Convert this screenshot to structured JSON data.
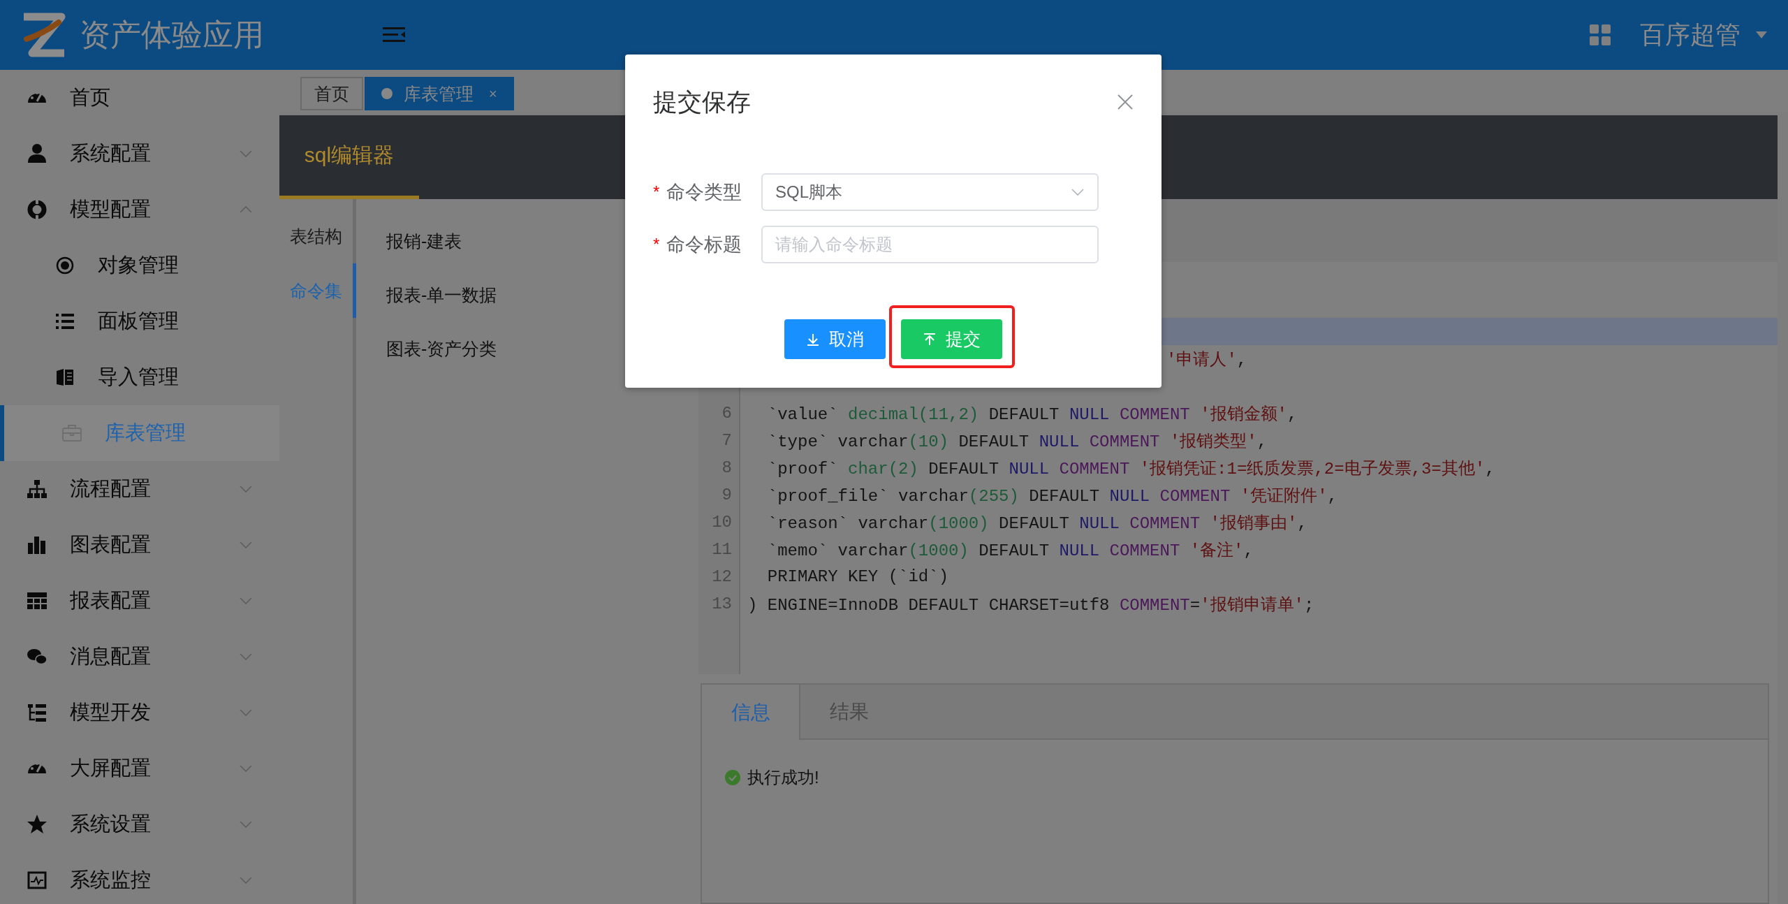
{
  "topbar": {
    "app_title": "资产体验应用",
    "user": "百序超管"
  },
  "sidebar": {
    "items": [
      {
        "label": "首页",
        "selected": false
      },
      {
        "label": "系统配置",
        "selected": false,
        "expanded": false
      },
      {
        "label": "模型配置",
        "selected": false,
        "expanded": true,
        "children": [
          {
            "label": "对象管理",
            "selected": false
          },
          {
            "label": "面板管理",
            "selected": false
          },
          {
            "label": "导入管理",
            "selected": false
          },
          {
            "label": "库表管理",
            "selected": true
          }
        ]
      },
      {
        "label": "流程配置",
        "selected": false,
        "expanded": false
      },
      {
        "label": "图表配置",
        "selected": false,
        "expanded": false
      },
      {
        "label": "报表配置",
        "selected": false,
        "expanded": false
      },
      {
        "label": "消息配置",
        "selected": false,
        "expanded": false
      },
      {
        "label": "模型开发",
        "selected": false,
        "expanded": false
      },
      {
        "label": "大屏配置",
        "selected": false,
        "expanded": false
      },
      {
        "label": "系统设置",
        "selected": false,
        "expanded": false
      },
      {
        "label": "系统监控",
        "selected": false,
        "expanded": false
      }
    ]
  },
  "page_tabs": [
    {
      "label": "首页",
      "selected": false
    },
    {
      "label": "库表管理",
      "selected": true,
      "close": "×"
    }
  ],
  "editor": {
    "tabs": [
      {
        "label": "sql编辑器",
        "selected": true
      }
    ],
    "side_tabs": [
      {
        "label": "表结构",
        "selected": false
      },
      {
        "label": "命令集",
        "selected": true
      }
    ],
    "commands": [
      "报销-建表",
      "报表-单一数据",
      "图表-资产分类"
    ],
    "code_lines": [
      {
        "active": true
      },
      {
        "clipped": true,
        "active": false,
        "tokens": [
          {
            "text": "'申请人'",
            "kind": "string"
          },
          {
            "text": ",",
            "kind": "plain"
          }
        ]
      },
      {
        "active": false
      },
      {
        "number": "6",
        "active": false,
        "tokens": [
          {
            "text": "  `value` ",
            "kind": "plain"
          },
          {
            "text": "decimal",
            "kind": "type"
          },
          {
            "text": "(11,2)",
            "kind": "number"
          },
          {
            "text": " DEFAULT ",
            "kind": "plain"
          },
          {
            "text": "NULL",
            "kind": "atom"
          },
          {
            "text": " COMMENT",
            "kind": "keyword"
          },
          {
            "text": " '报销金额'",
            "kind": "string"
          },
          {
            "text": ",",
            "kind": "plain"
          }
        ]
      },
      {
        "number": "7",
        "active": false,
        "tokens": [
          {
            "text": "  `type` varchar",
            "kind": "plain"
          },
          {
            "text": "(10)",
            "kind": "number"
          },
          {
            "text": " DEFAULT ",
            "kind": "plain"
          },
          {
            "text": "NULL",
            "kind": "atom"
          },
          {
            "text": " COMMENT",
            "kind": "keyword"
          },
          {
            "text": " '报销类型'",
            "kind": "string"
          },
          {
            "text": ",",
            "kind": "plain"
          }
        ]
      },
      {
        "number": "8",
        "active": false,
        "tokens": [
          {
            "text": "  `proof` ",
            "kind": "plain"
          },
          {
            "text": "char",
            "kind": "type"
          },
          {
            "text": "(2)",
            "kind": "number"
          },
          {
            "text": " DEFAULT ",
            "kind": "plain"
          },
          {
            "text": "NULL",
            "kind": "atom"
          },
          {
            "text": " COMMENT",
            "kind": "keyword"
          },
          {
            "text": " '报销凭证:1=纸质发票,2=电子发票,3=其他'",
            "kind": "string"
          },
          {
            "text": ",",
            "kind": "plain"
          }
        ]
      },
      {
        "number": "9",
        "active": false,
        "tokens": [
          {
            "text": "  `proof_file` varchar",
            "kind": "plain"
          },
          {
            "text": "(255)",
            "kind": "number"
          },
          {
            "text": " DEFAULT ",
            "kind": "plain"
          },
          {
            "text": "NULL",
            "kind": "atom"
          },
          {
            "text": " COMMENT",
            "kind": "keyword"
          },
          {
            "text": " '凭证附件'",
            "kind": "string"
          },
          {
            "text": ",",
            "kind": "plain"
          }
        ]
      },
      {
        "number": "10",
        "active": false,
        "tokens": [
          {
            "text": "  `reason` varchar",
            "kind": "plain"
          },
          {
            "text": "(1000)",
            "kind": "number"
          },
          {
            "text": " DEFAULT ",
            "kind": "plain"
          },
          {
            "text": "NULL",
            "kind": "atom"
          },
          {
            "text": " COMMENT",
            "kind": "keyword"
          },
          {
            "text": " '报销事由'",
            "kind": "string"
          },
          {
            "text": ",",
            "kind": "plain"
          }
        ]
      },
      {
        "number": "11",
        "active": false,
        "tokens": [
          {
            "text": "  `memo` varchar",
            "kind": "plain"
          },
          {
            "text": "(1000)",
            "kind": "number"
          },
          {
            "text": " DEFAULT ",
            "kind": "plain"
          },
          {
            "text": "NULL",
            "kind": "atom"
          },
          {
            "text": " COMMENT",
            "kind": "keyword"
          },
          {
            "text": " '备注'",
            "kind": "string"
          },
          {
            "text": ",",
            "kind": "plain"
          }
        ]
      },
      {
        "number": "12",
        "active": false,
        "tokens": [
          {
            "text": "  PRIMARY KEY (`id`)",
            "kind": "plain"
          }
        ]
      },
      {
        "number": "13",
        "active": false,
        "tokens": [
          {
            "text": ") ENGINE=InnoDB DEFAULT CHARSET=utf8 ",
            "kind": "plain"
          },
          {
            "text": "COMMENT",
            "kind": "keyword"
          },
          {
            "text": "=",
            "kind": "plain"
          },
          {
            "text": "'报销申请单'",
            "kind": "string"
          },
          {
            "text": ";",
            "kind": "plain"
          }
        ]
      }
    ],
    "result_tabs": [
      {
        "label": "信息",
        "selected": true
      },
      {
        "label": "结果",
        "selected": false
      }
    ],
    "message": {
      "text": "执行成功!",
      "success": true
    }
  },
  "dialog": {
    "title": "提交保存",
    "fields": [
      {
        "label": "命令类型",
        "required_mark": "*",
        "kind": "select",
        "value": "SQL脚本"
      },
      {
        "label": "命令标题",
        "required_mark": "*",
        "kind": "input",
        "placeholder": "请输入命令标题"
      }
    ],
    "buttons": [
      {
        "label": "取消",
        "kind": "cancel",
        "highlighted": false
      },
      {
        "label": "提交",
        "kind": "submit",
        "highlighted": true
      }
    ]
  }
}
